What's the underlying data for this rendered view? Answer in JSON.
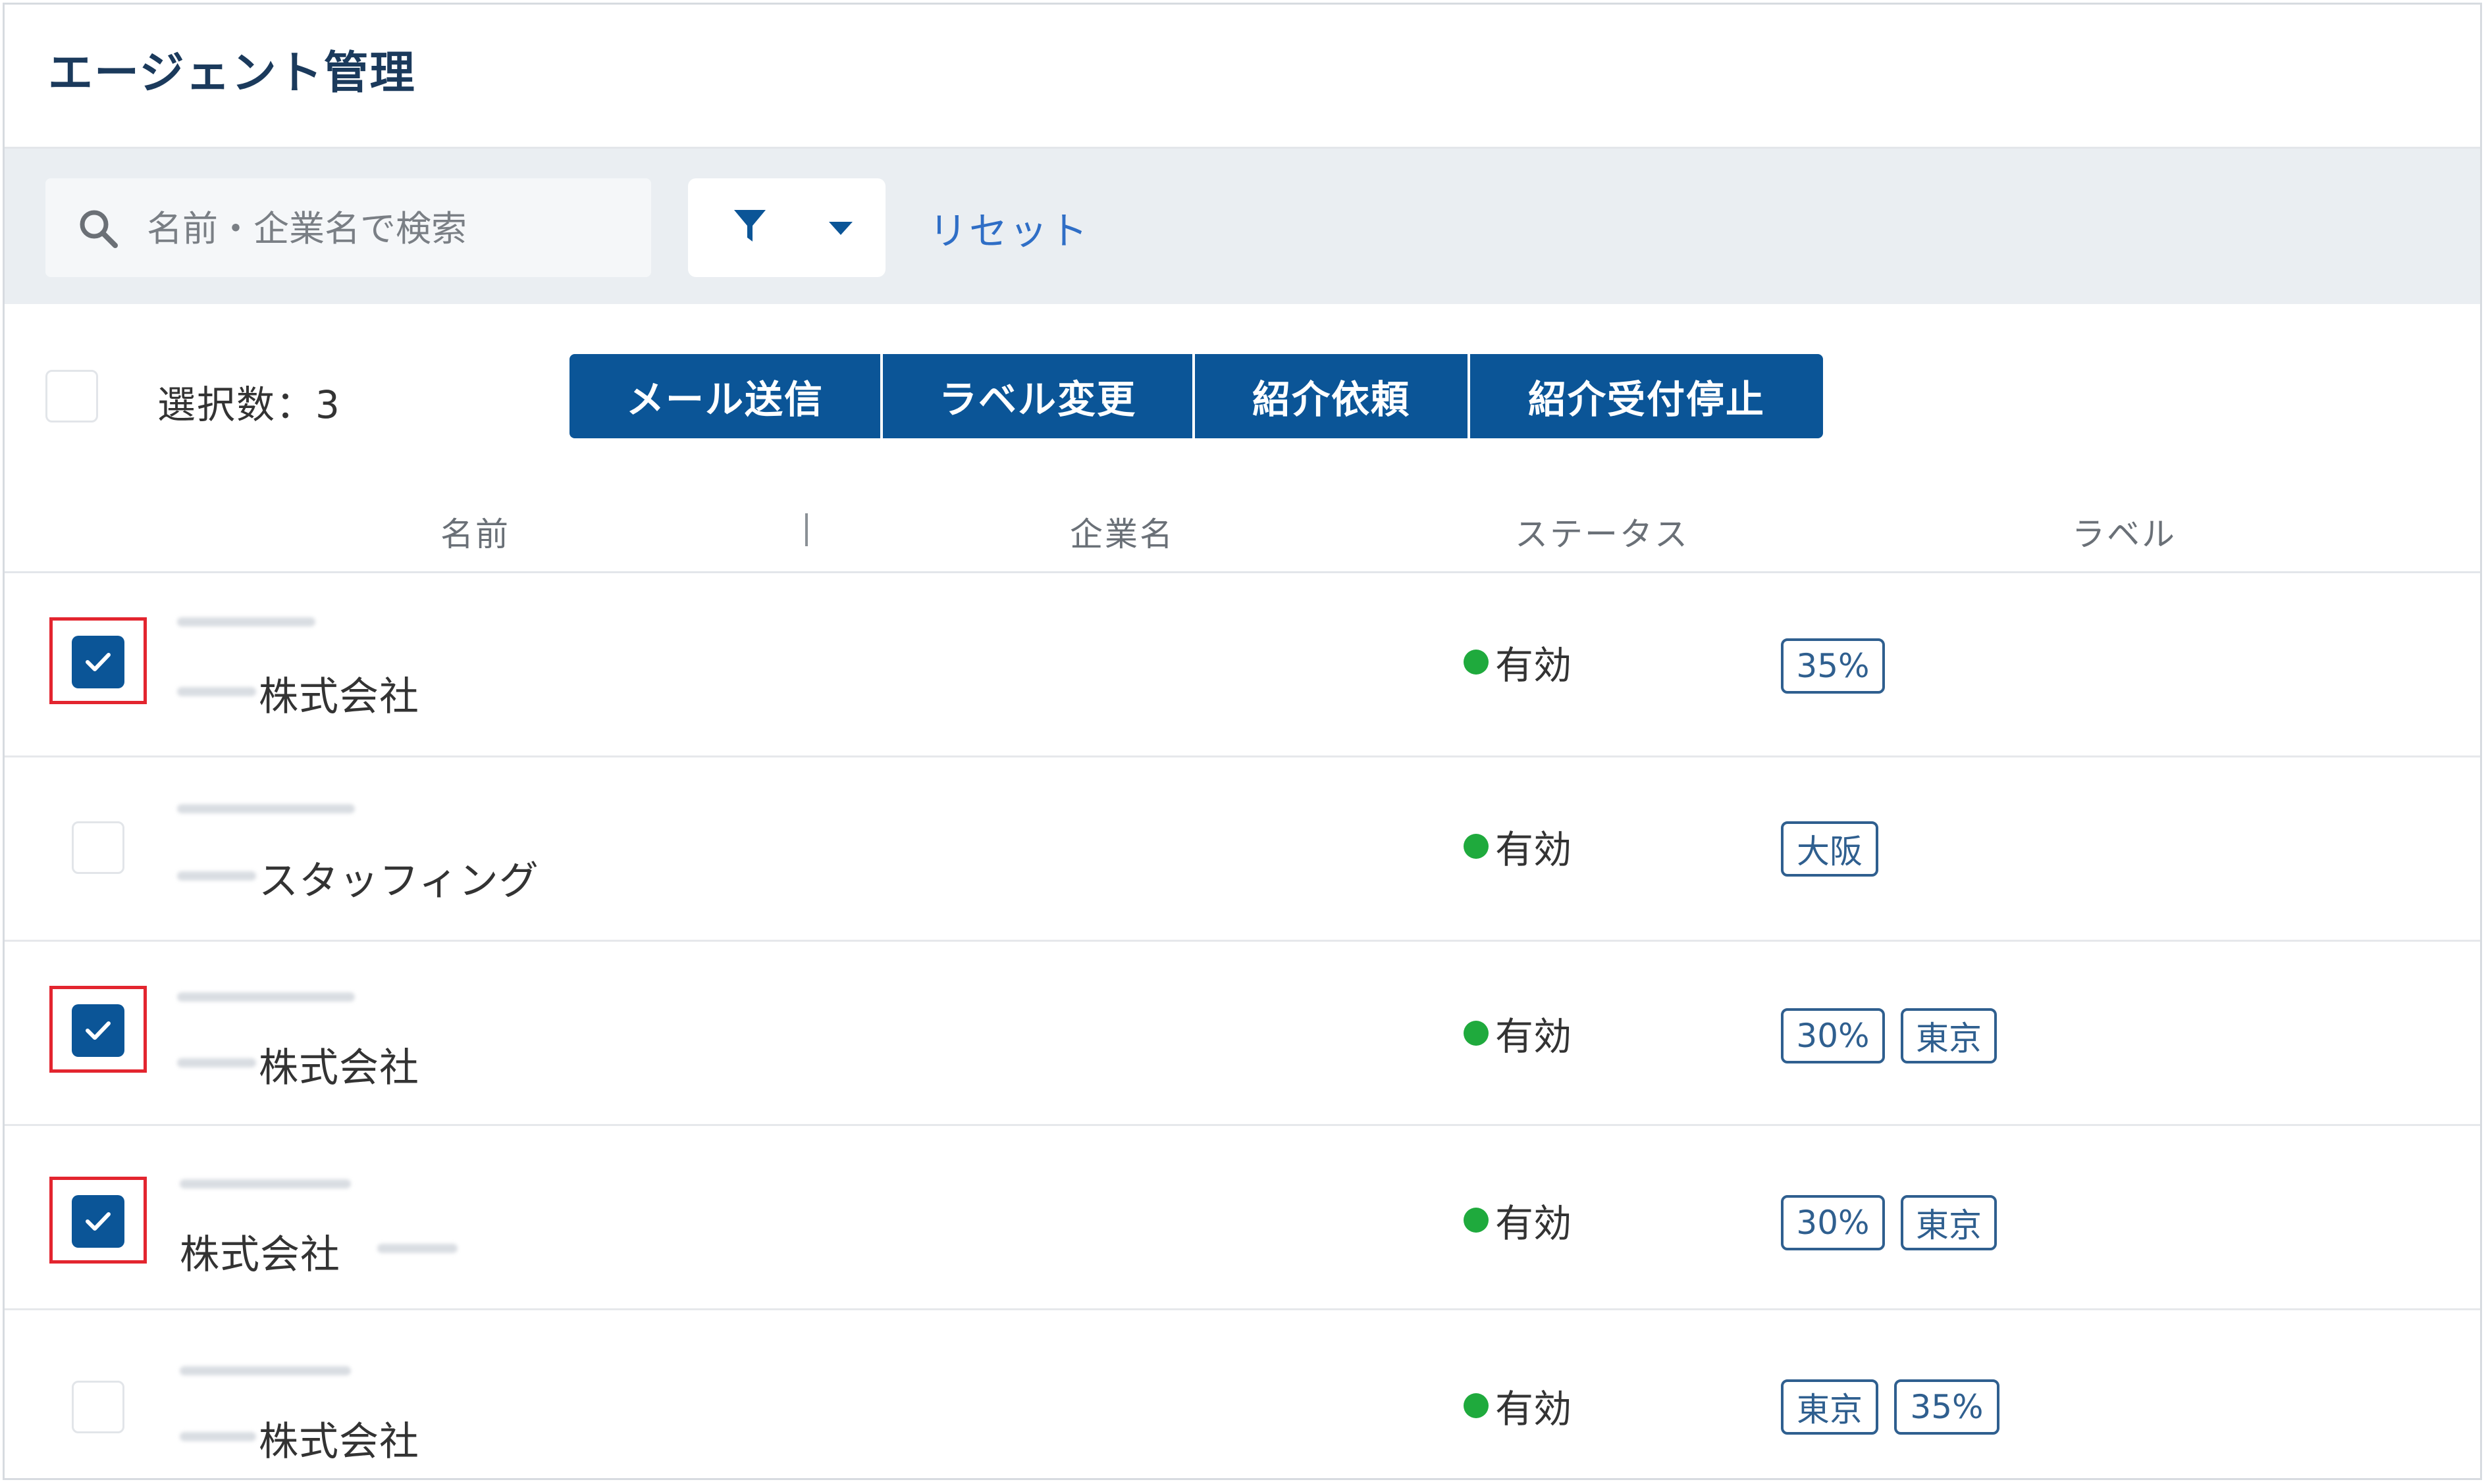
{
  "header": {
    "title": "エージェント管理"
  },
  "toolbar": {
    "search_placeholder": "名前・企業名で検索",
    "reset_label": "リセット"
  },
  "selection": {
    "count_text": "選択数：3",
    "actions": [
      "メール送信",
      "ラベル変更",
      "紹介依頼",
      "紹介受付停止"
    ]
  },
  "table": {
    "columns": [
      "名前",
      "企業名",
      "ステータス",
      "ラベル"
    ],
    "rows": [
      {
        "checked": true,
        "company": "株式会社",
        "status": "有効",
        "labels": [
          "35%"
        ]
      },
      {
        "checked": false,
        "company": "スタッフィング",
        "status": "有効",
        "labels": [
          "大阪"
        ]
      },
      {
        "checked": true,
        "company": "株式会社",
        "status": "有効",
        "labels": [
          "30%",
          "東京"
        ]
      },
      {
        "checked": true,
        "company": "株式会社",
        "status": "有効",
        "labels": [
          "30%",
          "東京"
        ]
      },
      {
        "checked": false,
        "company": "株式会社",
        "status": "有効",
        "labels": [
          "東京",
          "35%"
        ]
      }
    ]
  },
  "colors": {
    "primary": "#0b5597",
    "status_active": "#1faa3d",
    "highlight": "#e3252f",
    "link": "#2f6ec6"
  }
}
